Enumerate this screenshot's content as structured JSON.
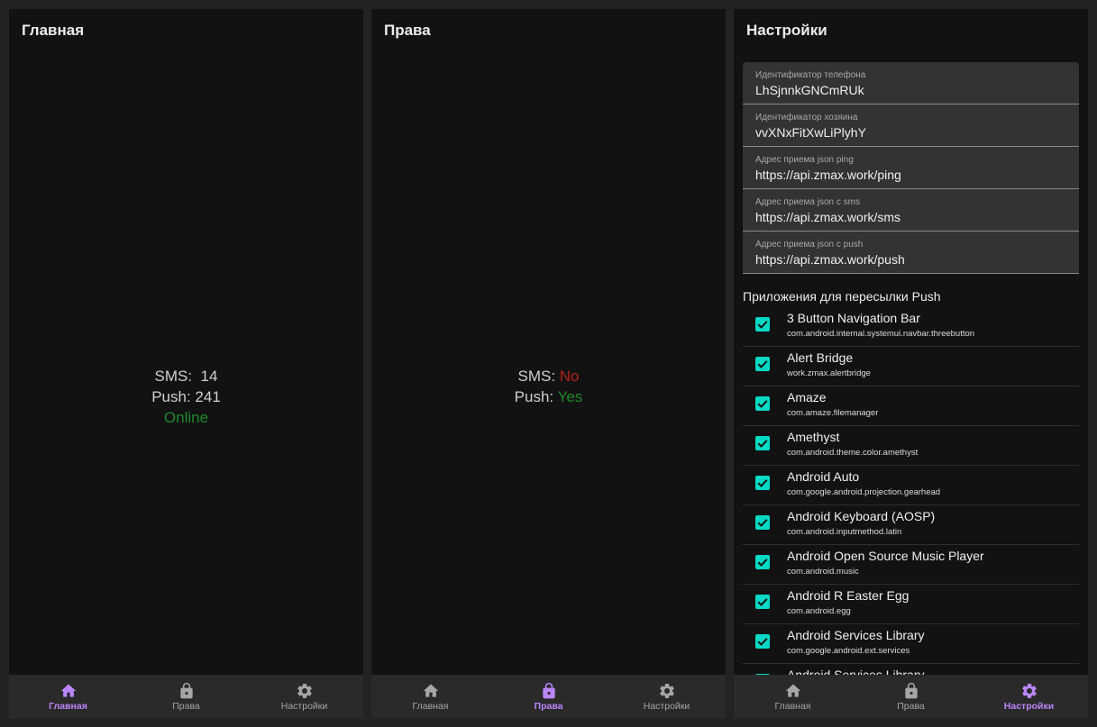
{
  "colors": {
    "accent": "#bb86fc",
    "checkbox": "#03dac5",
    "online": "#1f8a2c",
    "no": "#b3201a",
    "surface": "#121212",
    "nav": "#2a2a2a"
  },
  "nav": {
    "home": {
      "label": "Главная",
      "icon": "home-icon"
    },
    "rights": {
      "label": "Права",
      "icon": "lock-icon"
    },
    "settings": {
      "label": "Настройки",
      "icon": "gear-icon"
    }
  },
  "home": {
    "title": "Главная",
    "sms_label": "SMS:",
    "sms_value": "14",
    "push_label": "Push:",
    "push_value": "241",
    "status": "Online"
  },
  "rights": {
    "title": "Права",
    "sms_label": "SMS:",
    "sms_value": "No",
    "push_label": "Push:",
    "push_value": "Yes"
  },
  "settings": {
    "title": "Настройки",
    "fields": [
      {
        "label": "Идентификатор телефона",
        "value": "LhSjnnkGNCmRUk"
      },
      {
        "label": "Идентификатор хозяина",
        "value": "vvXNxFitXwLiPlyhY"
      },
      {
        "label": "Адрес приема json ping",
        "value": "https://api.zmax.work/ping"
      },
      {
        "label": "Адрес приема json с sms",
        "value": "https://api.zmax.work/sms"
      },
      {
        "label": "Адрес приема json с push",
        "value": "https://api.zmax.work/push"
      }
    ],
    "apps_heading": "Приложения для пересылки Push",
    "apps": [
      {
        "name": "3 Button Navigation Bar",
        "package": "com.android.internal.systemui.navbar.threebutton",
        "checked": true
      },
      {
        "name": "Alert Bridge",
        "package": "work.zmax.alertbridge",
        "checked": true
      },
      {
        "name": "Amaze",
        "package": "com.amaze.filemanager",
        "checked": true
      },
      {
        "name": "Amethyst",
        "package": "com.android.theme.color.amethyst",
        "checked": true
      },
      {
        "name": "Android Auto",
        "package": "com.google.android.projection.gearhead",
        "checked": true
      },
      {
        "name": "Android Keyboard (AOSP)",
        "package": "com.android.inputmethod.latin",
        "checked": true
      },
      {
        "name": "Android Open Source Music Player",
        "package": "com.android.music",
        "checked": true
      },
      {
        "name": "Android R Easter Egg",
        "package": "com.android.egg",
        "checked": true
      },
      {
        "name": "Android Services Library",
        "package": "com.google.android.ext.services",
        "checked": true
      },
      {
        "name": "Android Services Library",
        "package": "",
        "checked": true
      }
    ]
  }
}
